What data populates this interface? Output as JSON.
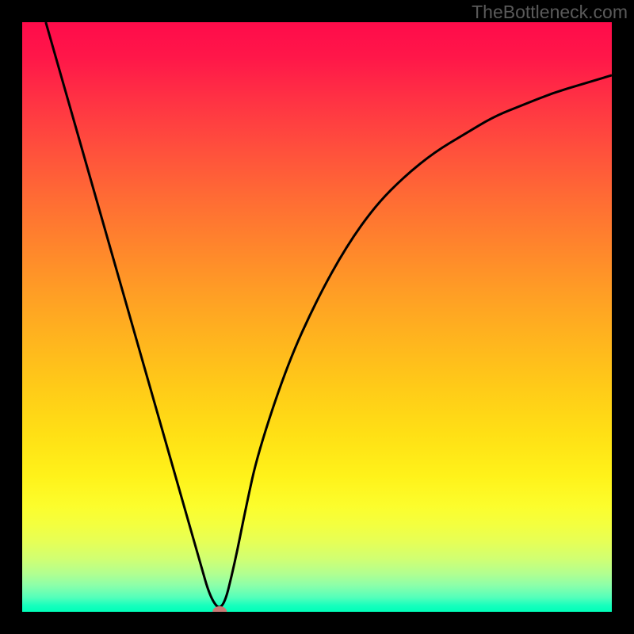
{
  "watermark": "TheBottleneck.com",
  "chart_data": {
    "type": "line",
    "title": "",
    "xlabel": "",
    "ylabel": "",
    "xlim": [
      0,
      100
    ],
    "ylim": [
      0,
      100
    ],
    "series": [
      {
        "name": "curve",
        "x": [
          4,
          6,
          8,
          10,
          12,
          14,
          16,
          18,
          20,
          22,
          24,
          26,
          28,
          30,
          32,
          34,
          36,
          38,
          40,
          45,
          50,
          55,
          60,
          65,
          70,
          75,
          80,
          85,
          90,
          95,
          100
        ],
        "values": [
          100,
          93,
          86,
          79,
          72,
          65,
          58,
          51,
          44,
          37,
          30,
          23,
          16,
          9,
          2,
          0,
          8,
          18,
          27,
          42,
          53,
          62,
          69,
          74,
          78,
          81,
          84,
          86,
          88,
          89.5,
          91
        ]
      }
    ],
    "marker": {
      "x": 33.5,
      "y": 0,
      "color": "#c97a76"
    },
    "gradient_stops": [
      {
        "offset": 0.0,
        "color": "#ff0b4a"
      },
      {
        "offset": 0.06,
        "color": "#ff1749"
      },
      {
        "offset": 0.14,
        "color": "#ff3543"
      },
      {
        "offset": 0.22,
        "color": "#ff513c"
      },
      {
        "offset": 0.3,
        "color": "#ff6c34"
      },
      {
        "offset": 0.38,
        "color": "#ff852c"
      },
      {
        "offset": 0.46,
        "color": "#ff9e25"
      },
      {
        "offset": 0.54,
        "color": "#ffb51e"
      },
      {
        "offset": 0.62,
        "color": "#ffcb18"
      },
      {
        "offset": 0.7,
        "color": "#ffe015"
      },
      {
        "offset": 0.77,
        "color": "#fff21a"
      },
      {
        "offset": 0.82,
        "color": "#fcfd2c"
      },
      {
        "offset": 0.85,
        "color": "#f4ff3e"
      },
      {
        "offset": 0.88,
        "color": "#e7ff55"
      },
      {
        "offset": 0.91,
        "color": "#d1ff72"
      },
      {
        "offset": 0.935,
        "color": "#b2ff90"
      },
      {
        "offset": 0.955,
        "color": "#8cffa9"
      },
      {
        "offset": 0.975,
        "color": "#56ffba"
      },
      {
        "offset": 0.99,
        "color": "#14ffbd"
      },
      {
        "offset": 1.0,
        "color": "#00ffb8"
      }
    ]
  }
}
